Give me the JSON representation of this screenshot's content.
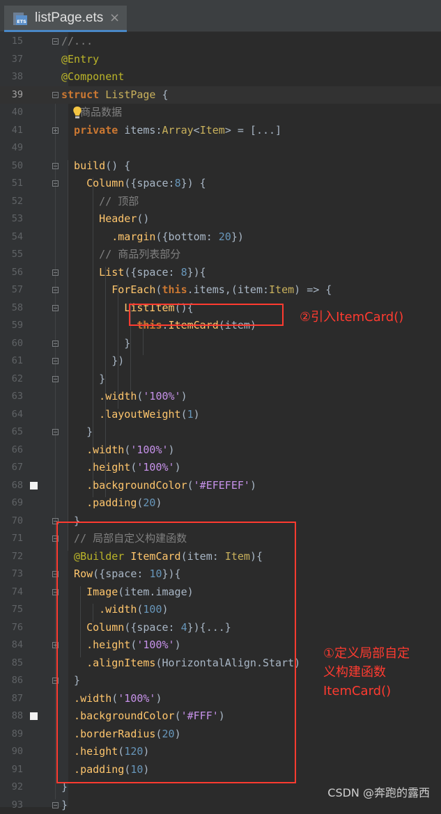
{
  "tab": {
    "icon_text": "ETS",
    "file_name": "listPage.ets",
    "close": "×"
  },
  "current_line": "39",
  "lines": [
    {
      "n": "15",
      "tokens": [
        {
          "c": "c",
          "t": "//..."
        }
      ]
    },
    {
      "n": "37",
      "tokens": [
        {
          "c": "a",
          "t": "@Entry"
        }
      ]
    },
    {
      "n": "38",
      "tokens": [
        {
          "c": "a",
          "t": "@Component"
        }
      ]
    },
    {
      "n": "39",
      "tokens": [
        {
          "c": "k",
          "t": "struct "
        },
        {
          "c": "t",
          "t": "ListPage "
        },
        {
          "c": "d",
          "t": "{"
        }
      ]
    },
    {
      "n": "40",
      "tokens": [
        {
          "c": "c",
          "t": "   商品数据"
        }
      ]
    },
    {
      "n": "41",
      "tokens": [
        {
          "c": "k",
          "t": "  private "
        },
        {
          "c": "d",
          "t": "items:"
        },
        {
          "c": "t",
          "t": "Array"
        },
        {
          "c": "d",
          "t": "<"
        },
        {
          "c": "t",
          "t": "Item"
        },
        {
          "c": "d",
          "t": "> = [...]"
        }
      ]
    },
    {
      "n": "49",
      "tokens": []
    },
    {
      "n": "50",
      "tokens": [
        {
          "c": "f",
          "t": "  build"
        },
        {
          "c": "d",
          "t": "() {"
        }
      ]
    },
    {
      "n": "51",
      "tokens": [
        {
          "c": "f",
          "t": "    Column"
        },
        {
          "c": "d",
          "t": "({space:"
        },
        {
          "c": "n",
          "t": "8"
        },
        {
          "c": "d",
          "t": "}) {"
        }
      ]
    },
    {
      "n": "52",
      "tokens": [
        {
          "c": "c",
          "t": "      // 顶部"
        }
      ]
    },
    {
      "n": "53",
      "tokens": [
        {
          "c": "f",
          "t": "      Header"
        },
        {
          "c": "d",
          "t": "()"
        }
      ]
    },
    {
      "n": "54",
      "tokens": [
        {
          "c": "f",
          "t": "        .margin"
        },
        {
          "c": "d",
          "t": "({bottom: "
        },
        {
          "c": "n",
          "t": "20"
        },
        {
          "c": "d",
          "t": "})"
        }
      ]
    },
    {
      "n": "55",
      "tokens": [
        {
          "c": "c",
          "t": "      // 商品列表部分"
        }
      ]
    },
    {
      "n": "56",
      "tokens": [
        {
          "c": "f",
          "t": "      List"
        },
        {
          "c": "d",
          "t": "({space: "
        },
        {
          "c": "n",
          "t": "8"
        },
        {
          "c": "d",
          "t": "}){"
        }
      ]
    },
    {
      "n": "57",
      "tokens": [
        {
          "c": "f",
          "t": "        ForEach"
        },
        {
          "c": "d",
          "t": "("
        },
        {
          "c": "k",
          "t": "this"
        },
        {
          "c": "d",
          "t": ".items,(item:"
        },
        {
          "c": "t",
          "t": "Item"
        },
        {
          "c": "d",
          "t": ") => {"
        }
      ]
    },
    {
      "n": "58",
      "tokens": [
        {
          "c": "f",
          "t": "          ListItem"
        },
        {
          "c": "d",
          "t": "(){"
        }
      ]
    },
    {
      "n": "59",
      "tokens": [
        {
          "c": "k",
          "t": "            this"
        },
        {
          "c": "d",
          "t": "."
        },
        {
          "c": "f",
          "t": "ItemCard"
        },
        {
          "c": "d",
          "t": "(item)"
        }
      ]
    },
    {
      "n": "60",
      "tokens": [
        {
          "c": "d",
          "t": "          }"
        }
      ]
    },
    {
      "n": "61",
      "tokens": [
        {
          "c": "d",
          "t": "        })"
        }
      ]
    },
    {
      "n": "62",
      "tokens": [
        {
          "c": "d",
          "t": "      }"
        }
      ]
    },
    {
      "n": "63",
      "tokens": [
        {
          "c": "f",
          "t": "      .width"
        },
        {
          "c": "d",
          "t": "("
        },
        {
          "c": "pk",
          "t": "'100%'"
        },
        {
          "c": "d",
          "t": ")"
        }
      ]
    },
    {
      "n": "64",
      "tokens": [
        {
          "c": "f",
          "t": "      .layoutWeight"
        },
        {
          "c": "d",
          "t": "("
        },
        {
          "c": "n",
          "t": "1"
        },
        {
          "c": "d",
          "t": ")"
        }
      ]
    },
    {
      "n": "65",
      "tokens": [
        {
          "c": "d",
          "t": "    }"
        }
      ]
    },
    {
      "n": "66",
      "tokens": [
        {
          "c": "f",
          "t": "    .width"
        },
        {
          "c": "d",
          "t": "("
        },
        {
          "c": "pk",
          "t": "'100%'"
        },
        {
          "c": "d",
          "t": ")"
        }
      ]
    },
    {
      "n": "67",
      "tokens": [
        {
          "c": "f",
          "t": "    .height"
        },
        {
          "c": "d",
          "t": "("
        },
        {
          "c": "pk",
          "t": "'100%'"
        },
        {
          "c": "d",
          "t": ")"
        }
      ]
    },
    {
      "n": "68",
      "tokens": [
        {
          "c": "f",
          "t": "    .backgroundColor"
        },
        {
          "c": "d",
          "t": "("
        },
        {
          "c": "pk",
          "t": "'#EFEFEF'"
        },
        {
          "c": "d",
          "t": ")"
        }
      ]
    },
    {
      "n": "69",
      "tokens": [
        {
          "c": "f",
          "t": "    .padding"
        },
        {
          "c": "d",
          "t": "("
        },
        {
          "c": "n",
          "t": "20"
        },
        {
          "c": "d",
          "t": ")"
        }
      ]
    },
    {
      "n": "70",
      "tokens": [
        {
          "c": "d",
          "t": "  }"
        }
      ]
    },
    {
      "n": "71",
      "tokens": [
        {
          "c": "c",
          "t": "  // 局部自定义构建函数"
        }
      ]
    },
    {
      "n": "72",
      "tokens": [
        {
          "c": "a",
          "t": "  @Builder "
        },
        {
          "c": "f",
          "t": "ItemCard"
        },
        {
          "c": "d",
          "t": "(item: "
        },
        {
          "c": "t",
          "t": "Item"
        },
        {
          "c": "d",
          "t": "){"
        }
      ]
    },
    {
      "n": "73",
      "tokens": [
        {
          "c": "f",
          "t": "  Row"
        },
        {
          "c": "d",
          "t": "({space: "
        },
        {
          "c": "n",
          "t": "10"
        },
        {
          "c": "d",
          "t": "}){"
        }
      ]
    },
    {
      "n": "74",
      "tokens": [
        {
          "c": "f",
          "t": "    Image"
        },
        {
          "c": "d",
          "t": "(item.image)"
        }
      ]
    },
    {
      "n": "75",
      "tokens": [
        {
          "c": "f",
          "t": "      .width"
        },
        {
          "c": "d",
          "t": "("
        },
        {
          "c": "n",
          "t": "100"
        },
        {
          "c": "d",
          "t": ")"
        }
      ]
    },
    {
      "n": "76",
      "tokens": [
        {
          "c": "f",
          "t": "    Column"
        },
        {
          "c": "d",
          "t": "({space: "
        },
        {
          "c": "n",
          "t": "4"
        },
        {
          "c": "d",
          "t": "}){...}"
        }
      ]
    },
    {
      "n": "84",
      "tokens": [
        {
          "c": "f",
          "t": "    .height"
        },
        {
          "c": "d",
          "t": "("
        },
        {
          "c": "pk",
          "t": "'100%'"
        },
        {
          "c": "d",
          "t": ")"
        }
      ]
    },
    {
      "n": "85",
      "tokens": [
        {
          "c": "f",
          "t": "    .alignItems"
        },
        {
          "c": "d",
          "t": "(HorizontalAlign.Start)"
        }
      ]
    },
    {
      "n": "86",
      "tokens": [
        {
          "c": "d",
          "t": "  }"
        }
      ]
    },
    {
      "n": "87",
      "tokens": [
        {
          "c": "f",
          "t": "  .width"
        },
        {
          "c": "d",
          "t": "("
        },
        {
          "c": "pk",
          "t": "'100%'"
        },
        {
          "c": "d",
          "t": ")"
        }
      ]
    },
    {
      "n": "88",
      "tokens": [
        {
          "c": "f",
          "t": "  .backgroundColor"
        },
        {
          "c": "d",
          "t": "("
        },
        {
          "c": "pk",
          "t": "'#FFF'"
        },
        {
          "c": "d",
          "t": ")"
        }
      ]
    },
    {
      "n": "89",
      "tokens": [
        {
          "c": "f",
          "t": "  .borderRadius"
        },
        {
          "c": "d",
          "t": "("
        },
        {
          "c": "n",
          "t": "20"
        },
        {
          "c": "d",
          "t": ")"
        }
      ]
    },
    {
      "n": "90",
      "tokens": [
        {
          "c": "f",
          "t": "  .height"
        },
        {
          "c": "d",
          "t": "("
        },
        {
          "c": "n",
          "t": "120"
        },
        {
          "c": "d",
          "t": ")"
        }
      ]
    },
    {
      "n": "91",
      "tokens": [
        {
          "c": "f",
          "t": "  .padding"
        },
        {
          "c": "d",
          "t": "("
        },
        {
          "c": "n",
          "t": "10"
        },
        {
          "c": "d",
          "t": ")"
        }
      ]
    },
    {
      "n": "92",
      "tokens": [
        {
          "c": "d",
          "t": "}"
        }
      ]
    },
    {
      "n": "93",
      "tokens": [
        {
          "c": "d",
          "t": "}"
        }
      ]
    }
  ],
  "annotations": {
    "import_note": "②引入ItemCard()",
    "define_note": [
      "①定义局部自定",
      "义构建函数",
      "ItemCard()"
    ]
  },
  "watermark": "CSDN @奔跑的露西",
  "colors": {
    "annotation": "#ff3b30",
    "background": "#2b2b2b"
  }
}
